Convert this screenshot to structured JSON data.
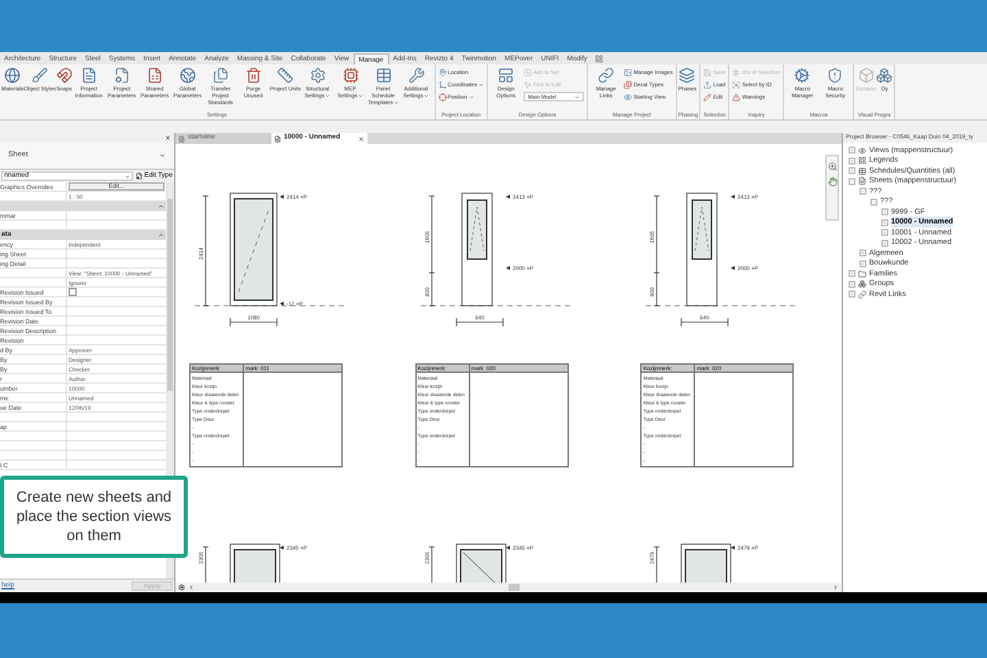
{
  "ribbon": {
    "tabs": [
      {
        "label": "Architecture",
        "selected": false
      },
      {
        "label": "Structure",
        "selected": false
      },
      {
        "label": "Steel",
        "selected": false
      },
      {
        "label": "Systems",
        "selected": false
      },
      {
        "label": "Insert",
        "selected": false
      },
      {
        "label": "Annotate",
        "selected": false
      },
      {
        "label": "Analyze",
        "selected": false
      },
      {
        "label": "Massing & Site",
        "selected": false
      },
      {
        "label": "Collaborate",
        "selected": false
      },
      {
        "label": "View",
        "selected": false
      },
      {
        "label": "Manage",
        "selected": true
      },
      {
        "label": "Add-Ins",
        "selected": false
      },
      {
        "label": "Revizto 4",
        "selected": false
      },
      {
        "label": "Twinmotion",
        "selected": false
      },
      {
        "label": "MEPover",
        "selected": false
      },
      {
        "label": "UNIFI",
        "selected": false
      },
      {
        "label": "Modify",
        "selected": false
      }
    ],
    "groups": [
      {
        "label": "Settings",
        "items": [
          {
            "kind": "large",
            "label": "Materials",
            "disabled": false,
            "has_menu": false
          },
          {
            "kind": "large",
            "label": "Object Styles",
            "disabled": false,
            "has_menu": false
          },
          {
            "kind": "large",
            "label": "Snaps",
            "disabled": false,
            "has_menu": false
          },
          {
            "kind": "large",
            "label": "Project Information",
            "disabled": false,
            "has_menu": false
          },
          {
            "kind": "large",
            "label": "Project Parameters",
            "disabled": false,
            "has_menu": false
          },
          {
            "kind": "large",
            "label": "Shared Parameters",
            "disabled": false,
            "has_menu": false
          },
          {
            "kind": "large",
            "label": "Global Parameters",
            "disabled": false,
            "has_menu": false
          },
          {
            "kind": "large",
            "label": "Transfer Project Standards",
            "disabled": false,
            "has_menu": false
          },
          {
            "kind": "large",
            "label": "Purge Unused",
            "disabled": false,
            "has_menu": false
          },
          {
            "kind": "large",
            "label": "Project Units",
            "disabled": false,
            "has_menu": false
          },
          {
            "kind": "large",
            "label": "Structural Settings",
            "disabled": false,
            "has_menu": true
          },
          {
            "kind": "large",
            "label": "MEP Settings",
            "disabled": false,
            "has_menu": true
          },
          {
            "kind": "large",
            "label": "Panel Schedule Templates",
            "disabled": false,
            "has_menu": true
          },
          {
            "kind": "large",
            "label": "Additional Settings",
            "disabled": false,
            "has_menu": true
          }
        ]
      },
      {
        "label": "Project Location",
        "items": [
          {
            "kind": "small",
            "label": "Location",
            "disabled": false,
            "has_menu": false
          },
          {
            "kind": "small",
            "label": "Coordinates",
            "disabled": false,
            "has_menu": true
          },
          {
            "kind": "small",
            "label": "Position",
            "disabled": false,
            "has_menu": true
          }
        ]
      },
      {
        "label": "Design Options",
        "items": [
          {
            "kind": "large",
            "label": "Design Options",
            "disabled": false,
            "has_menu": false
          },
          {
            "kind": "small",
            "label": "Add to Set",
            "disabled": true,
            "has_menu": false
          },
          {
            "kind": "small",
            "label": "Pick to Edit",
            "disabled": true,
            "has_menu": false
          },
          {
            "kind": "dropdown",
            "label": "Main Model",
            "disabled": false,
            "has_menu": true
          }
        ]
      },
      {
        "label": "Manage Project",
        "items": [
          {
            "kind": "large",
            "label": "Manage Links",
            "disabled": false,
            "has_menu": false
          },
          {
            "kind": "small",
            "label": "Manage Images",
            "disabled": false,
            "has_menu": false
          },
          {
            "kind": "small",
            "label": "Decal Types",
            "disabled": false,
            "has_menu": false
          },
          {
            "kind": "small",
            "label": "Starting View",
            "disabled": false,
            "has_menu": false
          }
        ]
      },
      {
        "label": "Phasing",
        "items": [
          {
            "kind": "large",
            "label": "Phases",
            "disabled": false,
            "has_menu": false
          }
        ]
      },
      {
        "label": "Selection",
        "items": [
          {
            "kind": "small",
            "label": "Save",
            "disabled": true,
            "has_menu": false
          },
          {
            "kind": "small",
            "label": "Load",
            "disabled": false,
            "has_menu": false
          },
          {
            "kind": "small",
            "label": "Edit",
            "disabled": false,
            "has_menu": false
          }
        ]
      },
      {
        "label": "Inquiry",
        "items": [
          {
            "kind": "small",
            "label": "IDs of Selection",
            "disabled": true,
            "has_menu": false
          },
          {
            "kind": "small",
            "label": "Select by ID",
            "disabled": false,
            "has_menu": false
          },
          {
            "kind": "small",
            "label": "Warnings",
            "disabled": false,
            "has_menu": false
          }
        ]
      },
      {
        "label": "Macros",
        "items": [
          {
            "kind": "large",
            "label": "Macro Manager",
            "disabled": false,
            "has_menu": false
          },
          {
            "kind": "large",
            "label": "Macro Security",
            "disabled": false,
            "has_menu": false
          }
        ]
      },
      {
        "label": "Visual Progra",
        "items": [
          {
            "kind": "large",
            "label": "Dynamo",
            "disabled": true,
            "has_menu": false
          },
          {
            "kind": "large",
            "label": "Dy",
            "disabled": false,
            "has_menu": false
          }
        ]
      }
    ]
  },
  "properties": {
    "type_name": "Sheet",
    "instance": "nnamed",
    "edit_type": "Edit Type",
    "rows": [
      {
        "kind": "button",
        "label": "Graphics Overrides",
        "value": "Edit..."
      },
      {
        "kind": "value",
        "value": "1 : 50"
      },
      {
        "kind": "section"
      },
      {
        "kind": "value",
        "label": "mmar"
      },
      {
        "kind": "value"
      },
      {
        "kind": "section",
        "label": "ata"
      },
      {
        "kind": "value",
        "label": "ency",
        "value": "Independent"
      },
      {
        "kind": "value",
        "label": "ing Sheet"
      },
      {
        "kind": "value",
        "label": "ing Detail"
      },
      {
        "kind": "value",
        "value": "View: \"Sheet: 10000 - Unnamed\""
      },
      {
        "kind": "value",
        "value": "Ignorer"
      },
      {
        "kind": "checkbox",
        "label": "Revision Issued",
        "checked": false
      },
      {
        "kind": "value",
        "label": "Revision Issued By"
      },
      {
        "kind": "value",
        "label": "Revision Issued To"
      },
      {
        "kind": "value",
        "label": "Revision Date"
      },
      {
        "kind": "value",
        "label": "Revision Description"
      },
      {
        "kind": "value",
        "label": "Revision"
      },
      {
        "kind": "value",
        "label": "d By",
        "value": "Approver"
      },
      {
        "kind": "value",
        "label": "By",
        "value": "Designer"
      },
      {
        "kind": "value",
        "label": "By",
        "value": "Checker"
      },
      {
        "kind": "value",
        "label": "r",
        "value": "Author"
      },
      {
        "kind": "value",
        "label": "umber",
        "value": "10000"
      },
      {
        "kind": "value",
        "label": "me",
        "value": "Unnamed"
      },
      {
        "kind": "value",
        "label": "ue Date",
        "value": "12/06/19"
      },
      {
        "kind": "value"
      },
      {
        "kind": "value",
        "label": "ap"
      },
      {
        "kind": "value"
      },
      {
        "kind": "value"
      },
      {
        "kind": "value"
      },
      {
        "kind": "value",
        "label": "I C"
      }
    ],
    "help": "help",
    "apply": "Apply"
  },
  "callout": "Create new sheets and place the section views on them",
  "view_tabs": [
    {
      "label": "startview",
      "selected": false
    },
    {
      "label": "10000 - Unnamed",
      "selected": true
    }
  ],
  "sheet": {
    "elevations": [
      {
        "kind": "full_glass",
        "height_dims": [
          "2414"
        ],
        "width_dim": "1080",
        "levels": [
          "2414 +P",
          "-17 +P"
        ]
      },
      {
        "kind": "upper_glass",
        "height_dims": [
          "1605",
          "800"
        ],
        "width_dim": "640",
        "levels": [
          "2413 +P",
          "2000 +P"
        ]
      },
      {
        "kind": "upper_glass",
        "height_dims": [
          "1605",
          "800"
        ],
        "width_dim": "640",
        "levels": [
          "2413 +P",
          "2000 +P"
        ]
      }
    ],
    "tables": [
      {
        "header": "Kozijnmerk:",
        "mark": "mark: 011",
        "rows": [
          "Materiaal",
          "Kleur kozijn",
          "Kleur draaiende delen",
          "Kleur & type rooster",
          "Type onderdorpel",
          "Type Deur",
          "-",
          "Type onderdorpel",
          "-",
          "-",
          "-"
        ]
      },
      {
        "header": "Kozijnmerk:",
        "mark": "mark: 020",
        "rows": [
          "Materiaal",
          "Kleur kozijn",
          "Kleur draaiende delen",
          "Kleur & type rooster",
          "Type onderdorpel",
          "Type Deur",
          "-",
          "Type onderdorpel",
          "-",
          "-",
          "-"
        ]
      },
      {
        "header": "Kozijnmerk:",
        "mark": "mark: 020",
        "rows": [
          "Materiaal",
          "Kleur kozijn",
          "Kleur draaiende delen",
          "Kleur & type rooster",
          "Type onderdorpel",
          "Type Deur",
          "-",
          "Type onderdorpel",
          "-",
          "-",
          "-"
        ]
      }
    ],
    "lower_elevations": [
      {
        "kind": "full_glass",
        "height_dims": [
          "2305"
        ],
        "levels": [
          "2345 +P"
        ]
      },
      {
        "kind": "swing_glass",
        "height_dims": [
          "2305"
        ],
        "levels": [
          "2345 +P"
        ]
      },
      {
        "kind": "full_glass",
        "height_dims": [
          "2479"
        ],
        "levels": [
          "2479 +P"
        ]
      }
    ]
  },
  "browser": {
    "title": "Project Browser - C0546_Kaap Duin 04_2019_ty",
    "tree": [
      {
        "label": "Views (mappenstructuur)",
        "expanded": false,
        "selected": false
      },
      {
        "label": "Legends",
        "expanded": false,
        "selected": false
      },
      {
        "label": "Schedules/Quantities (all)",
        "expanded": false,
        "selected": false
      },
      {
        "label": "Sheets (mappenstructuur)",
        "expanded": true,
        "selected": false,
        "children": [
          {
            "label": "???",
            "expanded": true,
            "selected": false,
            "children": [
              {
                "label": "???",
                "expanded": true,
                "selected": false,
                "children": [
                  {
                    "label": "9999 - GF",
                    "expanded": false,
                    "selected": false
                  },
                  {
                    "label": "10000 - Unnamed",
                    "expanded": false,
                    "selected": true
                  },
                  {
                    "label": "10001 - Unnamed",
                    "expanded": false,
                    "selected": false
                  },
                  {
                    "label": "10002 - Unnamed",
                    "expanded": false,
                    "selected": false
                  }
                ]
              }
            ]
          },
          {
            "label": "Algemeen",
            "expanded": false,
            "selected": false
          },
          {
            "label": "Bouwkunde",
            "expanded": false,
            "selected": false
          }
        ]
      },
      {
        "label": "Families",
        "expanded": false,
        "selected": false
      },
      {
        "label": "Groups",
        "expanded": false,
        "selected": false
      },
      {
        "label": "Revit Links",
        "expanded": false,
        "selected": false
      }
    ]
  }
}
